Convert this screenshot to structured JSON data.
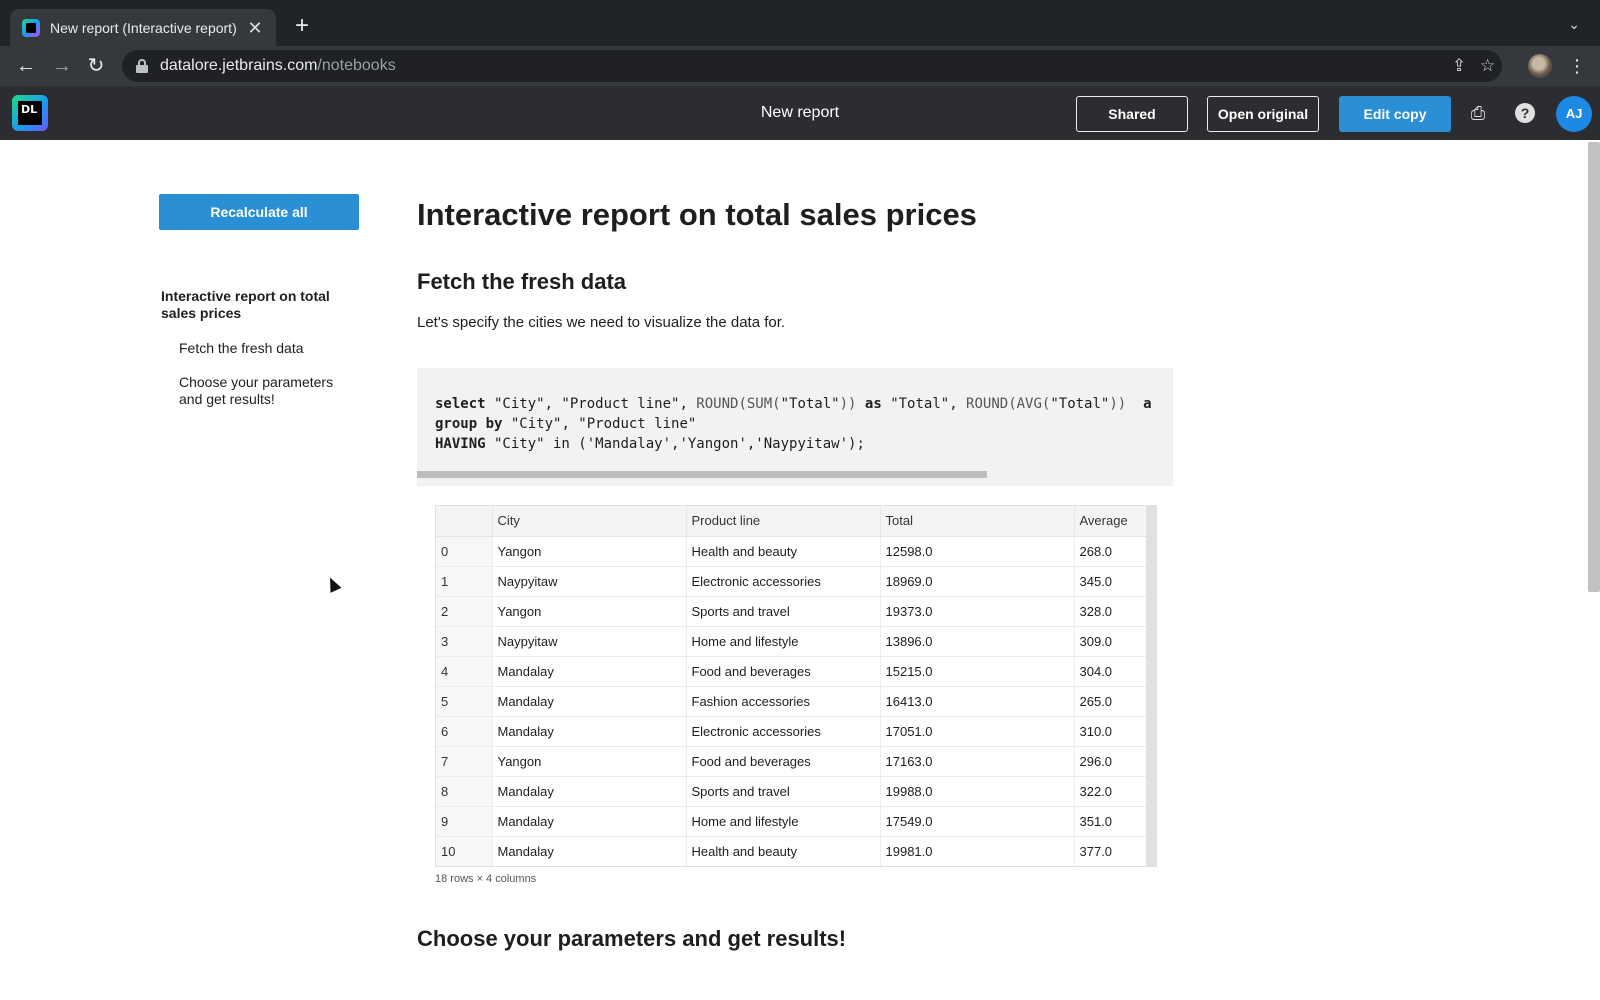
{
  "browser": {
    "tab_title": "New report (Interactive report)",
    "url_host": "datalore.jetbrains.com",
    "url_path": "/notebooks"
  },
  "app": {
    "logo_text": "DL",
    "title": "New report",
    "buttons": {
      "shared": "Shared",
      "open_original": "Open original",
      "edit_copy": "Edit copy"
    },
    "user_initials": "AJ",
    "accent_color": "#2a8fd4"
  },
  "sidebar": {
    "recalculate_label": "Recalculate all",
    "toc": [
      {
        "label": "Interactive report on total sales prices",
        "level": 1
      },
      {
        "label": "Fetch the fresh data",
        "level": 2
      },
      {
        "label": "Choose your parameters and get results!",
        "level": 2
      }
    ]
  },
  "main": {
    "title": "Interactive report on total sales prices",
    "section1_heading": "Fetch the fresh data",
    "section1_text": "Let's specify the cities we need to visualize the data for.",
    "section2_heading": "Choose your parameters and get results!",
    "code": {
      "line1_kw1": "select",
      "line1_a": " \"City\", \"Product line\", ",
      "line1_fn1": "ROUND(SUM(",
      "line1_b": "\"Total\"",
      "line1_fn2": "))",
      "line1_kw2": " as ",
      "line1_c": "\"Total\", ",
      "line1_fn3": "ROUND(AVG(",
      "line1_d": "\"Total\"",
      "line1_fn4": "))",
      "line1_e": "  a",
      "line2_kw": "group by",
      "line2_rest": " \"City\", \"Product line\"",
      "line3_kw": "HAVING",
      "line3_rest": " \"City\" in ('Mandalay','Yangon','Naypyitaw');"
    },
    "table": {
      "columns": [
        "",
        "City",
        "Product line",
        "Total",
        "Average"
      ],
      "rows": [
        [
          "0",
          "Yangon",
          "Health and beauty",
          "12598.0",
          "268.0"
        ],
        [
          "1",
          "Naypyitaw",
          "Electronic accessories",
          "18969.0",
          "345.0"
        ],
        [
          "2",
          "Yangon",
          "Sports and travel",
          "19373.0",
          "328.0"
        ],
        [
          "3",
          "Naypyitaw",
          "Home and lifestyle",
          "13896.0",
          "309.0"
        ],
        [
          "4",
          "Mandalay",
          "Food and beverages",
          "15215.0",
          "304.0"
        ],
        [
          "5",
          "Mandalay",
          "Fashion accessories",
          "16413.0",
          "265.0"
        ],
        [
          "6",
          "Mandalay",
          "Electronic accessories",
          "17051.0",
          "310.0"
        ],
        [
          "7",
          "Yangon",
          "Food and beverages",
          "17163.0",
          "296.0"
        ],
        [
          "8",
          "Mandalay",
          "Sports and travel",
          "19988.0",
          "322.0"
        ],
        [
          "9",
          "Mandalay",
          "Home and lifestyle",
          "17549.0",
          "351.0"
        ],
        [
          "10",
          "Mandalay",
          "Health and beauty",
          "19981.0",
          "377.0"
        ]
      ],
      "meta": "18 rows × 4 columns"
    }
  },
  "icons": {
    "back": "←",
    "forward": "→",
    "reload": "↻",
    "close": "✕",
    "plus": "+",
    "share": "⇪",
    "star": "☆",
    "menu": "⋮",
    "print": "⎙",
    "help": "?",
    "tab_menu": "⌄"
  }
}
